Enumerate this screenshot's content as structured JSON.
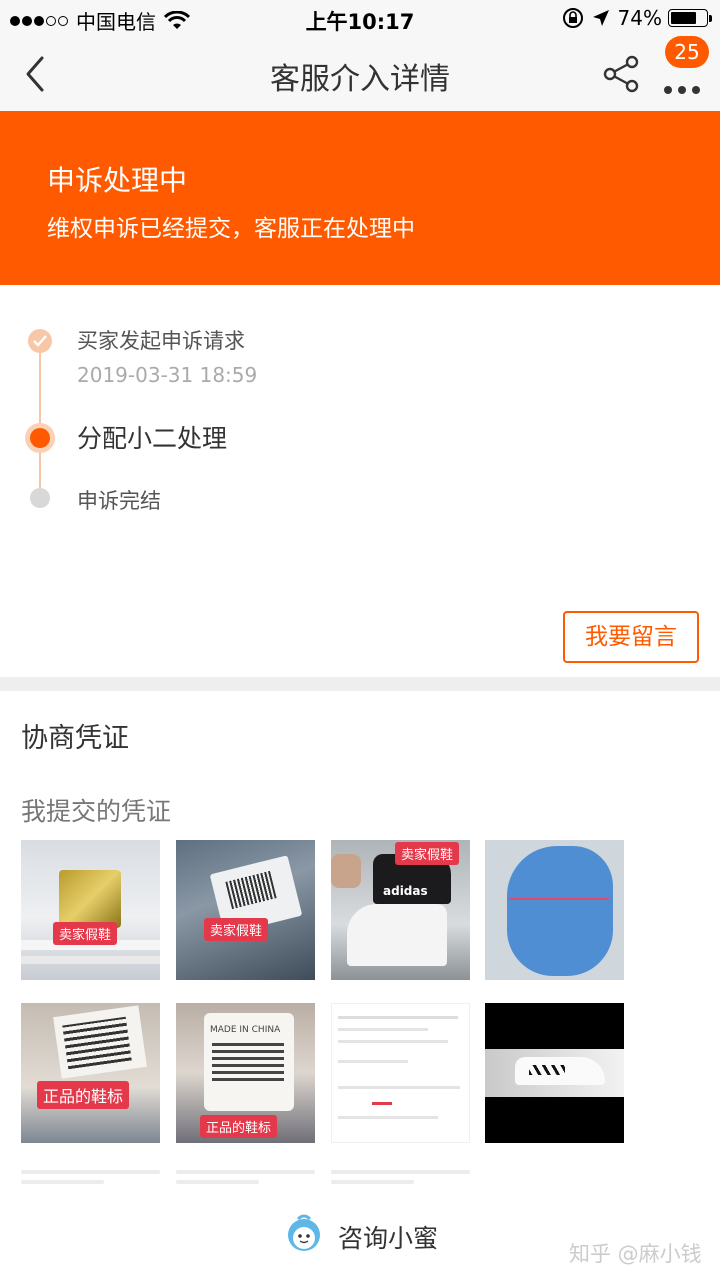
{
  "status_bar": {
    "carrier": "中国电信",
    "time": "上午10:17",
    "battery": "74%"
  },
  "nav": {
    "title": "客服介入详情",
    "badge": "25"
  },
  "banner": {
    "title": "申诉处理中",
    "subtitle": "维权申诉已经提交，客服正在处理中",
    "color": "#ff5a00"
  },
  "timeline": {
    "steps": [
      {
        "label": "买家发起申诉请求",
        "time": "2019-03-31 18:59"
      },
      {
        "label": "分配小二处理"
      },
      {
        "label": "申诉完结"
      }
    ]
  },
  "actions": {
    "leave_message": "我要留言"
  },
  "evidence": {
    "section_title": "协商凭证",
    "sub_title": "我提交的凭证",
    "photo_labels": [
      "卖家假鞋",
      "卖家假鞋",
      "卖家假鞋",
      "正品的鞋标",
      "正品的鞋标"
    ],
    "photo_text": [
      "adidas",
      "MADE IN CHINA"
    ]
  },
  "footer": {
    "consult_label": "咨询小蜜"
  },
  "watermark": "知乎 @麻小钱"
}
